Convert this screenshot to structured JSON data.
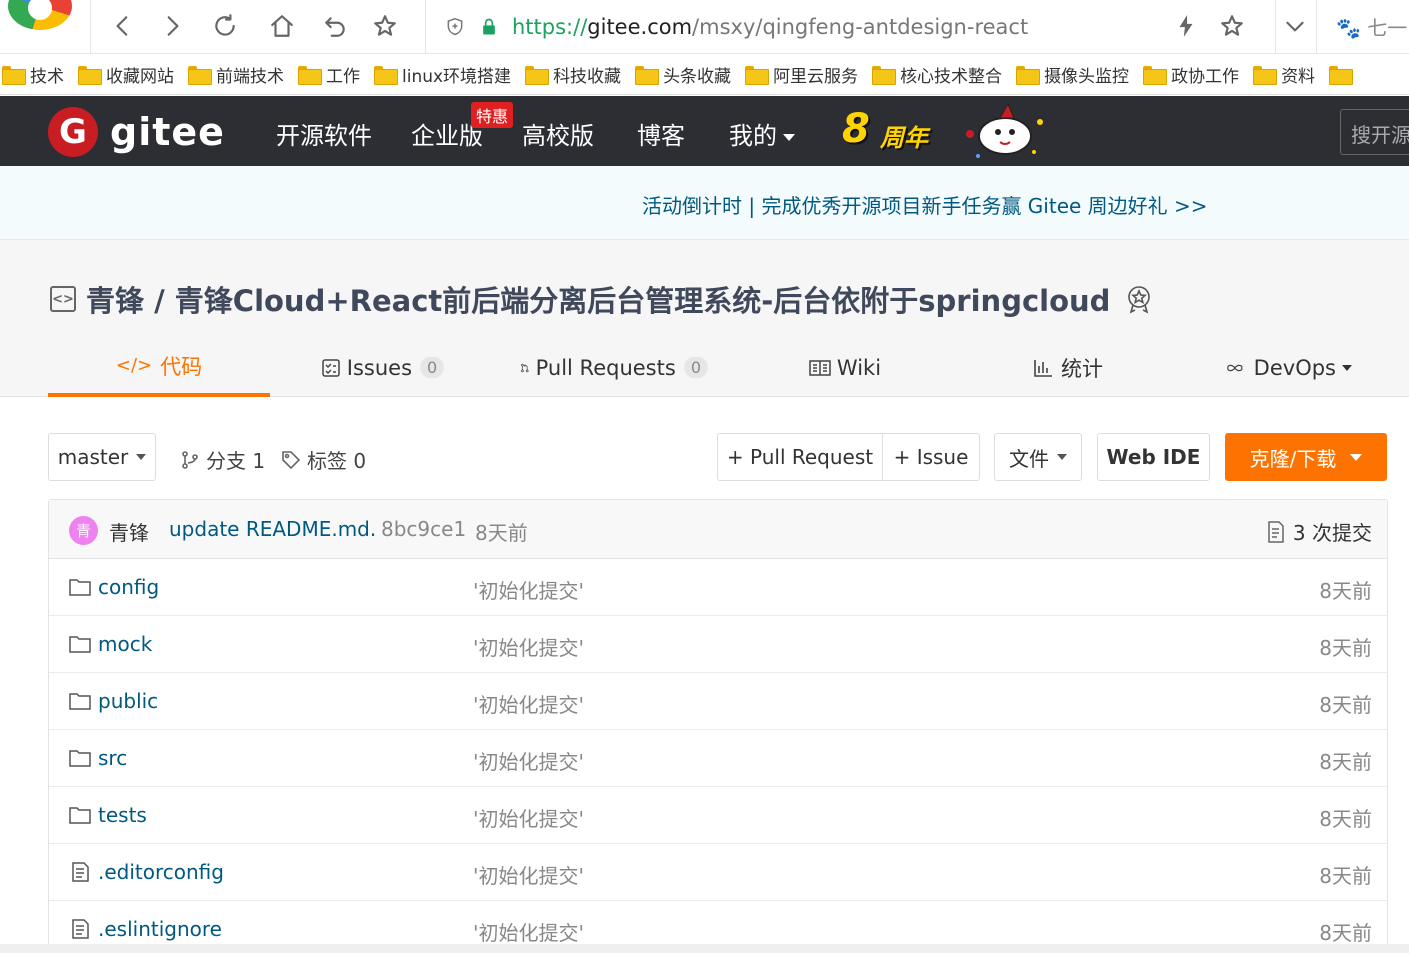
{
  "browser": {
    "url_scheme": "https://",
    "url_host": "gitee.com",
    "url_path": "/msxy/qingfeng-antdesign-react",
    "right_text": "七一"
  },
  "bookmarks": [
    "技术",
    "收藏网站",
    "前端技术",
    "工作",
    "linux环境搭建",
    "科技收藏",
    "头条收藏",
    "阿里云服务",
    "核心技术整合",
    "摄像头监控",
    "政协工作",
    "资料",
    ""
  ],
  "gitee": {
    "logo_text": "gitee",
    "logo_letter": "G",
    "nav": {
      "open_source": "开源软件",
      "enterprise": "企业版",
      "enterprise_badge": "特惠",
      "education": "高校版",
      "blog": "博客",
      "mine": "我的"
    },
    "anniversary_num": "8",
    "anniversary_word": "周年",
    "search_placeholder": "搜开源"
  },
  "activity_banner": "活动倒计时 | 完成优秀开源项目新手任务赢 Gitee 周边好礼 >>",
  "project": {
    "repo_icon": "<>",
    "title": "青锋 / 青锋Cloud+React前后端分离后台管理系统-后台依附于springcloud",
    "tabs": {
      "code": "代码",
      "code_icon": "</>",
      "issues": "Issues",
      "issues_count": "0",
      "pull_requests": "Pull Requests",
      "pr_count": "0",
      "wiki": "Wiki",
      "stats": "统计",
      "devops": "DevOps"
    }
  },
  "toolbar": {
    "branch": "master",
    "branches": "分支 1",
    "tags": "标签 0",
    "new_pr": "+ Pull Request",
    "new_issue": "+ Issue",
    "file": "文件",
    "web_ide": "Web IDE",
    "clone": "克隆/下载"
  },
  "latest_commit": {
    "avatar_char": "青",
    "author": "青锋",
    "message": "update README.md.",
    "sha": "8bc9ce1",
    "time": "8天前",
    "count": "3 次提交"
  },
  "files": [
    {
      "name": "config",
      "type": "folder",
      "message": "'初始化提交'",
      "time": "8天前"
    },
    {
      "name": "mock",
      "type": "folder",
      "message": "'初始化提交'",
      "time": "8天前"
    },
    {
      "name": "public",
      "type": "folder",
      "message": "'初始化提交'",
      "time": "8天前"
    },
    {
      "name": "src",
      "type": "folder",
      "message": "'初始化提交'",
      "time": "8天前"
    },
    {
      "name": "tests",
      "type": "folder",
      "message": "'初始化提交'",
      "time": "8天前"
    },
    {
      "name": ".editorconfig",
      "type": "file",
      "message": "'初始化提交'",
      "time": "8天前"
    },
    {
      "name": ".eslintignore",
      "type": "file",
      "message": "'初始化提交'",
      "time": "8天前"
    }
  ],
  "colors": {
    "brand_red": "#c71d23",
    "accent_orange": "#fe7300",
    "link_blue": "#005980",
    "header_dark": "#2c2e33"
  }
}
